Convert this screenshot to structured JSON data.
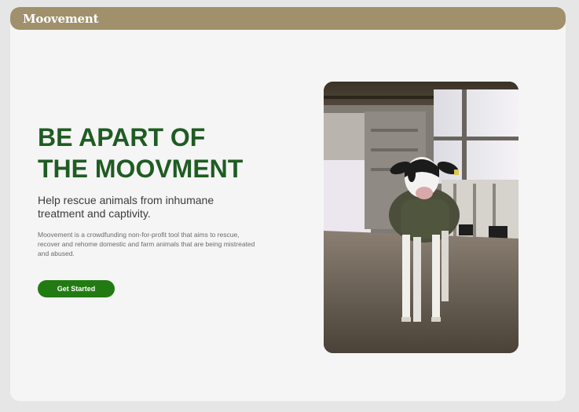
{
  "navbar": {
    "brand": "Moovement"
  },
  "hero": {
    "headline_line1": "BE APART OF",
    "headline_line2": "THE MOOVMENT",
    "subheadline": "Help rescue animals from inhumane treatment and captivity.",
    "description": "Moovement is a crowdfunding non-for-profit tool that aims to rescue, recover and rehome domestic and farm animals that are being mistreated and abused.",
    "cta_label": "Get Started"
  },
  "colors": {
    "navbar": "#a0916c",
    "headline": "#1f5c22",
    "cta": "#217b12",
    "card": "#f5f5f5"
  },
  "hero_image": {
    "subject": "calf-in-barn-photo"
  }
}
